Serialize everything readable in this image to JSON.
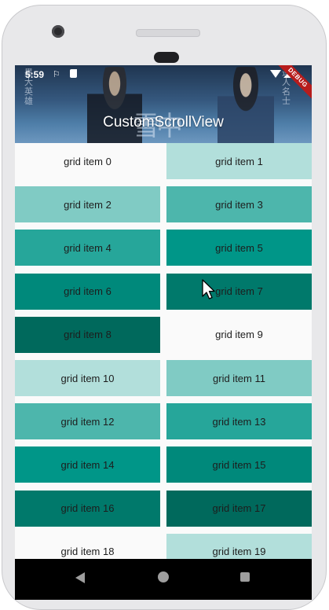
{
  "status_bar": {
    "time": "5:59",
    "debug_label": "DEBUG"
  },
  "app_bar": {
    "title": "CustomScrollView"
  },
  "grid": {
    "items": [
      {
        "label": "grid item 0",
        "color": "#fafafa"
      },
      {
        "label": "grid item 1",
        "color": "#b2dfdb"
      },
      {
        "label": "grid item 2",
        "color": "#80cbc4"
      },
      {
        "label": "grid item 3",
        "color": "#4db6ac"
      },
      {
        "label": "grid item 4",
        "color": "#26a69a"
      },
      {
        "label": "grid item 5",
        "color": "#009688"
      },
      {
        "label": "grid item 6",
        "color": "#00897b"
      },
      {
        "label": "grid item 7",
        "color": "#00796b"
      },
      {
        "label": "grid item 8",
        "color": "#00695c"
      },
      {
        "label": "grid item 9",
        "color": "#fafafa"
      },
      {
        "label": "grid item 10",
        "color": "#b2dfdb"
      },
      {
        "label": "grid item 11",
        "color": "#80cbc4"
      },
      {
        "label": "grid item 12",
        "color": "#4db6ac"
      },
      {
        "label": "grid item 13",
        "color": "#26a69a"
      },
      {
        "label": "grid item 14",
        "color": "#009688"
      },
      {
        "label": "grid item 15",
        "color": "#00897b"
      },
      {
        "label": "grid item 16",
        "color": "#00796b"
      },
      {
        "label": "grid item 17",
        "color": "#00695c"
      },
      {
        "label": "grid item 18",
        "color": "#fafafa"
      },
      {
        "label": "grid item 19",
        "color": "#b2dfdb"
      }
    ]
  },
  "nav_bar": {
    "back_icon": "back-icon",
    "home_icon": "home-icon",
    "recents_icon": "recents-icon"
  }
}
